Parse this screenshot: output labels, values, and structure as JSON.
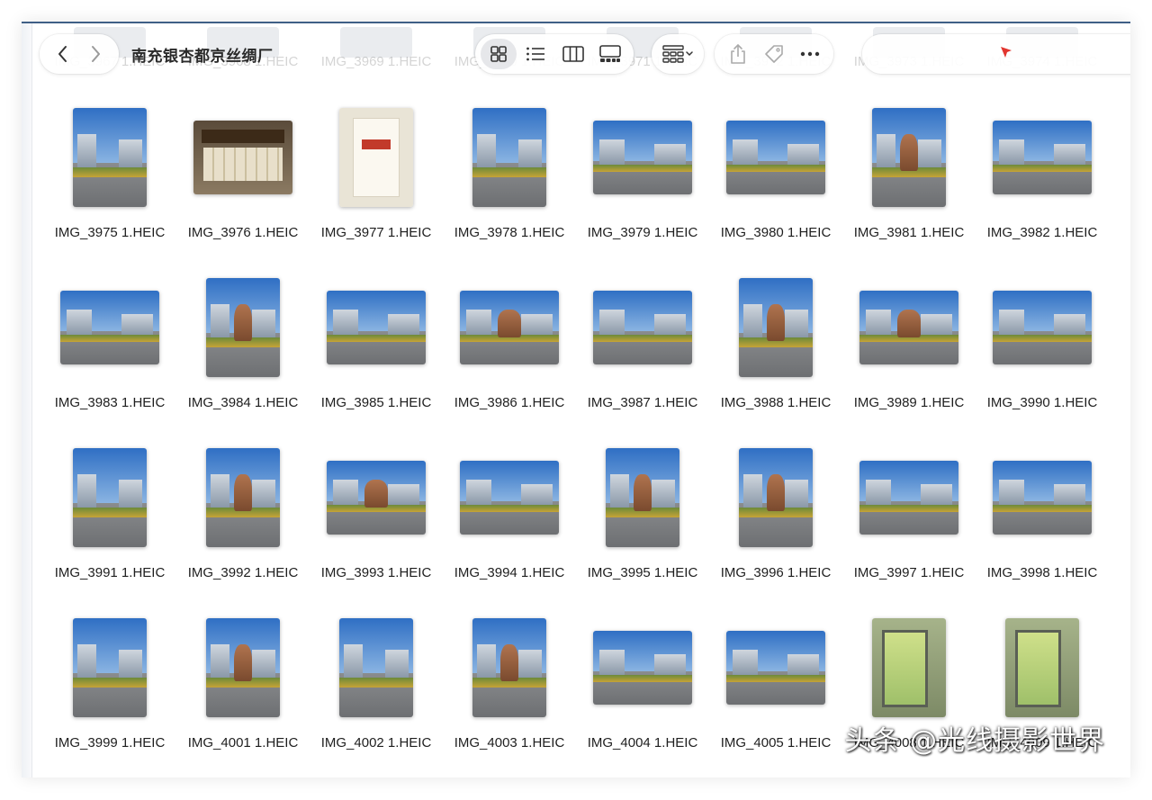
{
  "window": {
    "title": "南充银杏都京丝绸厂"
  },
  "ghost_row": [
    "IMG_3967 1.HEIC",
    "IMG_3968 1.HEIC",
    "IMG_3969 1.HEIC",
    "IMG_3970 1.HEIC",
    "IMG_3971 1.HEIC",
    "IMG_3972 1.HEIC",
    "IMG_3973 1.HEIC",
    "IMG_3974 1.HEIC"
  ],
  "toolbar": {
    "back_icon": "chevron-left-icon",
    "forward_icon": "chevron-right-icon",
    "view_modes": [
      {
        "name": "icon-view",
        "icon": "grid-icon",
        "active": true
      },
      {
        "name": "list-view",
        "icon": "list-icon",
        "active": false
      },
      {
        "name": "column-view",
        "icon": "columns-icon",
        "active": false
      },
      {
        "name": "gallery-view",
        "icon": "gallery-icon",
        "active": false
      }
    ],
    "group_icon": "group-grid-icon",
    "actions": [
      "share-icon",
      "tag-icon",
      "more-icon"
    ],
    "search_placeholder": ""
  },
  "files": [
    {
      "name": "IMG_3975 1.HEIC",
      "kind": "portrait"
    },
    {
      "name": "IMG_3976 1.HEIC",
      "kind": "shop"
    },
    {
      "name": "IMG_3977 1.HEIC",
      "kind": "poster"
    },
    {
      "name": "IMG_3978 1.HEIC",
      "kind": "portrait"
    },
    {
      "name": "IMG_3979 1.HEIC",
      "kind": "landscape"
    },
    {
      "name": "IMG_3980 1.HEIC",
      "kind": "landscape"
    },
    {
      "name": "IMG_3981 1.HEIC",
      "kind": "portrait-statue"
    },
    {
      "name": "IMG_3982 1.HEIC",
      "kind": "landscape"
    },
    {
      "name": "IMG_3983 1.HEIC",
      "kind": "landscape"
    },
    {
      "name": "IMG_3984 1.HEIC",
      "kind": "portrait-statue"
    },
    {
      "name": "IMG_3985 1.HEIC",
      "kind": "landscape"
    },
    {
      "name": "IMG_3986 1.HEIC",
      "kind": "landscape-statue"
    },
    {
      "name": "IMG_3987 1.HEIC",
      "kind": "landscape"
    },
    {
      "name": "IMG_3988 1.HEIC",
      "kind": "portrait-statue"
    },
    {
      "name": "IMG_3989 1.HEIC",
      "kind": "landscape-statue"
    },
    {
      "name": "IMG_3990 1.HEIC",
      "kind": "landscape"
    },
    {
      "name": "IMG_3991 1.HEIC",
      "kind": "portrait"
    },
    {
      "name": "IMG_3992 1.HEIC",
      "kind": "portrait-statue"
    },
    {
      "name": "IMG_3993 1.HEIC",
      "kind": "landscape-statue"
    },
    {
      "name": "IMG_3994 1.HEIC",
      "kind": "landscape"
    },
    {
      "name": "IMG_3995 1.HEIC",
      "kind": "portrait-statue"
    },
    {
      "name": "IMG_3996 1.HEIC",
      "kind": "portrait-statue"
    },
    {
      "name": "IMG_3997 1.HEIC",
      "kind": "landscape"
    },
    {
      "name": "IMG_3998 1.HEIC",
      "kind": "landscape"
    },
    {
      "name": "IMG_3999 1.HEIC",
      "kind": "portrait"
    },
    {
      "name": "IMG_4001 1.HEIC",
      "kind": "portrait-statue"
    },
    {
      "name": "IMG_4002 1.HEIC",
      "kind": "portrait"
    },
    {
      "name": "IMG_4003 1.HEIC",
      "kind": "portrait-statue"
    },
    {
      "name": "IMG_4004 1.HEIC",
      "kind": "landscape"
    },
    {
      "name": "IMG_4005 1.HEIC",
      "kind": "landscape"
    },
    {
      "name": "IMG_4008 1.HEIC",
      "kind": "kiosk"
    },
    {
      "name": "IMG_4009 1.HEIC",
      "kind": "kiosk"
    }
  ],
  "watermark": "头条 @光线摄影世界",
  "colors": {
    "accent_border": "#3f5f86",
    "active_view_bg": "#e6e7ea"
  }
}
